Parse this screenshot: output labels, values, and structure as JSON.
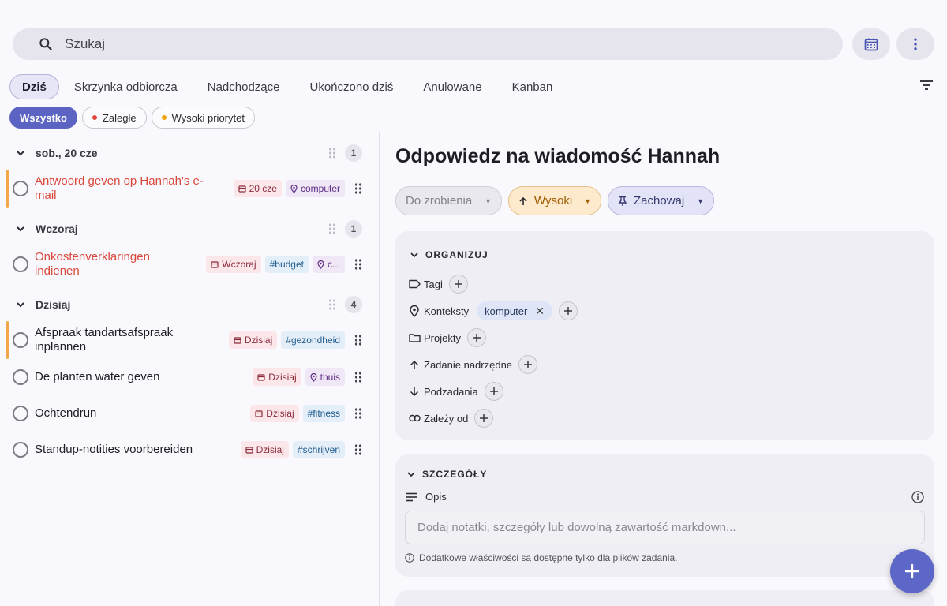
{
  "search": {
    "placeholder": "Szukaj"
  },
  "tabs": [
    {
      "label": "Dziś"
    },
    {
      "label": "Skrzynka odbiorcza"
    },
    {
      "label": "Nadchodzące"
    },
    {
      "label": "Ukończono dziś"
    },
    {
      "label": "Anulowane"
    },
    {
      "label": "Kanban"
    }
  ],
  "filters": [
    {
      "label": "Wszystko"
    },
    {
      "label": "Zaległe",
      "dot_color": "#e0463a"
    },
    {
      "label": "Wysoki priorytet",
      "dot_color": "#f0a30a"
    }
  ],
  "groups": [
    {
      "title": "sob., 20 cze",
      "count": "1",
      "tasks": [
        {
          "title": "Antwoord geven op Hannah's e-mail",
          "date": "20 cze",
          "context": "computer"
        }
      ]
    },
    {
      "title": "Wczoraj",
      "count": "1",
      "tasks": [
        {
          "title": "Onkostenverklaringen indienen",
          "date": "Wczoraj",
          "project": "#budget",
          "context": "c..."
        }
      ]
    },
    {
      "title": "Dzisiaj",
      "count": "4",
      "tasks": [
        {
          "title": "Afspraak tandartsafspraak inplannen",
          "date": "Dzisiaj",
          "project": "#gezondheid"
        },
        {
          "title": "De planten water geven",
          "date": "Dzisiaj",
          "context": "thuis"
        },
        {
          "title": "Ochtendrun",
          "date": "Dzisiaj",
          "project": "#fitness"
        },
        {
          "title": "Standup-notities voorbereiden",
          "date": "Dzisiaj",
          "project": "#schrijven"
        }
      ]
    }
  ],
  "detail": {
    "title": "Odpowiedz na wiadomość Hannah",
    "status": "Do zrobienia",
    "priority": "Wysoki",
    "keep": "Zachowaj",
    "organize": {
      "heading": "ORGANIZUJ",
      "tags_label": "Tagi",
      "contexts_label": "Konteksty",
      "context_value": "komputer",
      "projects_label": "Projekty",
      "parent_label": "Zadanie nadrzędne",
      "subtasks_label": "Podzadania",
      "depends_label": "Zależy od"
    },
    "details": {
      "heading": "SZCZEGÓŁY",
      "description_label": "Opis",
      "notes_placeholder": "Dodaj notatki, szczegóły lub dowolną zawartość markdown...",
      "hint": "Dodatkowe właściwości są dostępne tylko dla plików zadania."
    }
  },
  "colors": {
    "accent": "#5b64c2",
    "overdue": "#d9483b",
    "priority_bar": "#f2a84a"
  }
}
